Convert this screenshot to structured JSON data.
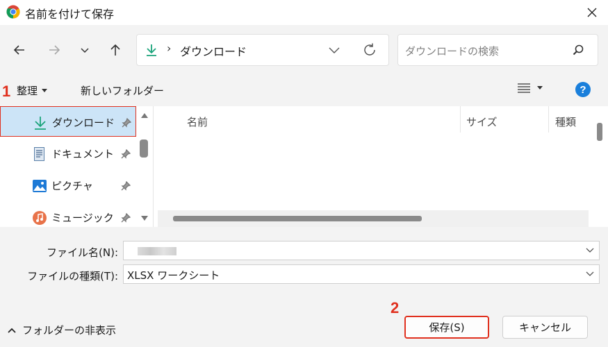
{
  "window": {
    "title": "名前を付けて保存"
  },
  "address": {
    "location": "ダウンロード"
  },
  "search": {
    "placeholder": "ダウンロードの検索"
  },
  "commandbar": {
    "organize": "整理",
    "new_folder": "新しいフォルダー"
  },
  "steps": {
    "one": "1",
    "two": "2"
  },
  "sidebar": {
    "items": [
      {
        "label": "ダウンロード",
        "icon": "download-icon",
        "selected": true
      },
      {
        "label": "ドキュメント",
        "icon": "document-icon"
      },
      {
        "label": "ピクチャ",
        "icon": "picture-icon"
      },
      {
        "label": "ミュージック",
        "icon": "music-icon"
      }
    ]
  },
  "file_list": {
    "columns": [
      "名前",
      "サイズ",
      "種類"
    ]
  },
  "fields": {
    "filename_label": "ファイル名(N):",
    "filename_value": "",
    "filetype_label": "ファイルの種類(T):",
    "filetype_value": "XLSX ワークシート"
  },
  "footer": {
    "hide_folders": "フォルダーの非表示",
    "save": "保存(S)",
    "cancel": "キャンセル"
  },
  "colors": {
    "accent": "#0078d4",
    "highlight": "#e0301e",
    "selection": "#cce4f7",
    "download_green": "#1aa37a"
  }
}
